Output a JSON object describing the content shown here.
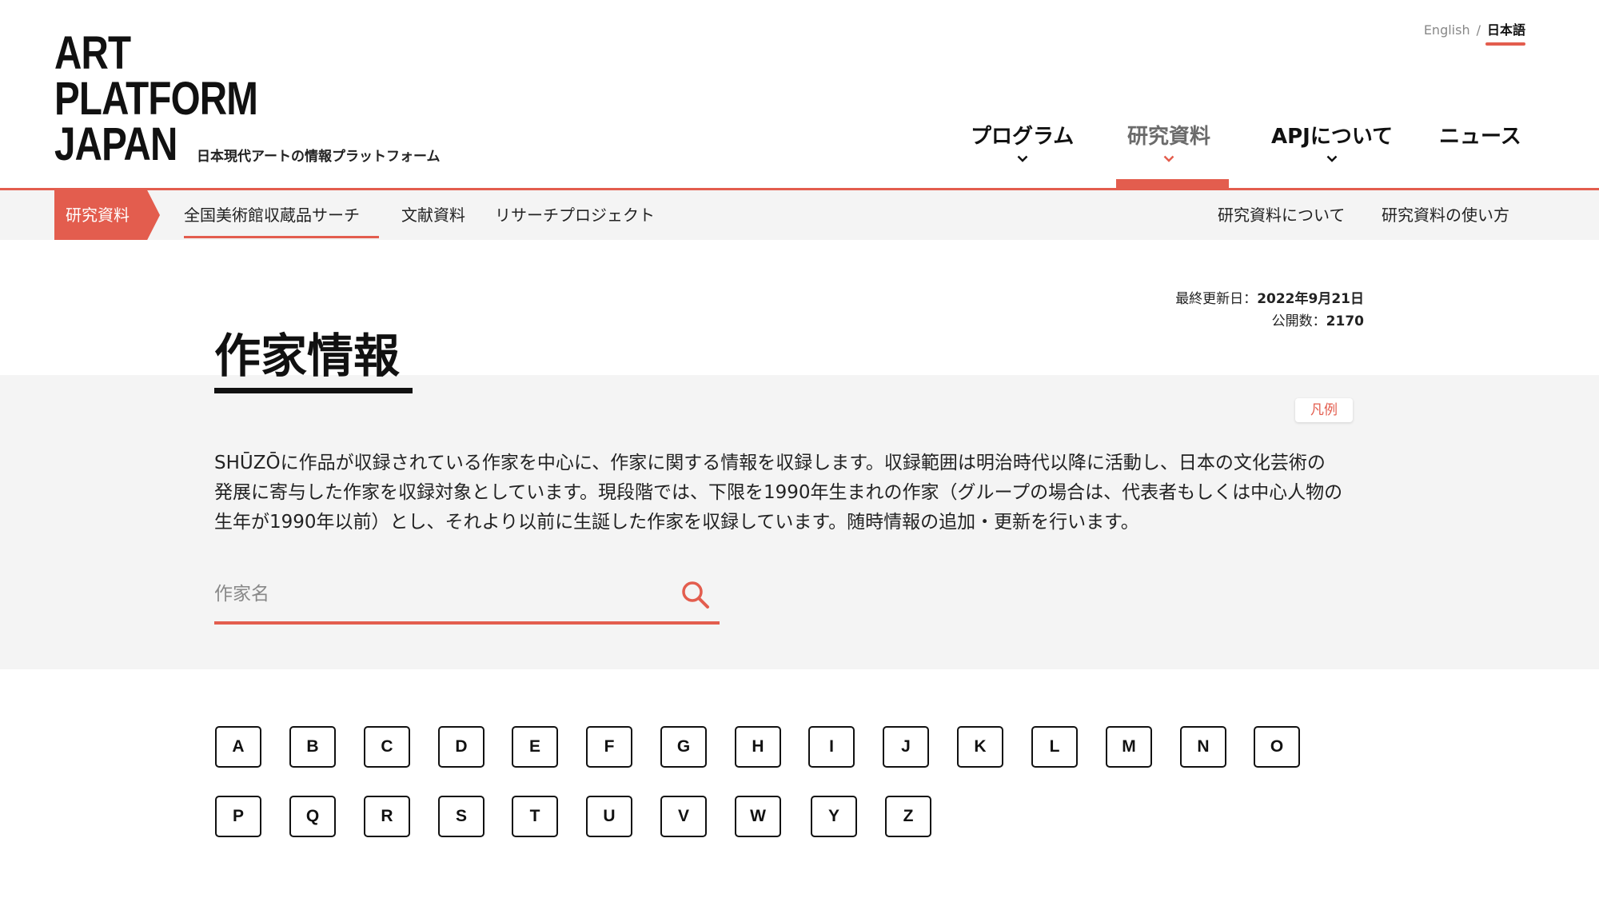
{
  "header": {
    "logo_lines": [
      "ART",
      "PLATFORM",
      "JAPAN"
    ],
    "tagline": "日本現代アートの情報プラットフォーム",
    "lang": {
      "en": "English",
      "separator": "/",
      "ja": "日本語"
    },
    "nav": [
      {
        "label": "プログラム",
        "has_dropdown": true
      },
      {
        "label": "研究資料",
        "has_dropdown": true,
        "active": true
      },
      {
        "label": "APJについて",
        "has_dropdown": true
      },
      {
        "label": "ニュース",
        "has_dropdown": false
      }
    ]
  },
  "subnav": {
    "tag": "研究資料",
    "left_links": [
      "全国美術館収蔵品サーチ",
      "文献資料",
      "リサーチプロジェクト"
    ],
    "right_links": [
      "研究資料について",
      "研究資料の使い方"
    ]
  },
  "meta": {
    "updated_label": "最終更新日：",
    "updated_value": "2022年9月21日",
    "count_label": "公開数：",
    "count_value": "2170"
  },
  "page": {
    "title": "作家情報",
    "legend_button": "凡例",
    "description_lines": [
      "SHŪZŌに作品が収録されている作家を中心に、作家に関する情報を収録します。収録範囲は明治時代以降に活動し、日本の文化芸術の",
      "発展に寄与した作家を収録対象としています。現段階では、下限を1990年生まれの作家（グループの場合は、代表者もしくは中心人物の",
      "生年が1990年以前）とし、それより以前に生誕した作家を収録しています。随時情報の追加・更新を行います。"
    ]
  },
  "search": {
    "placeholder": "作家名",
    "value": "",
    "icon": "search-icon"
  },
  "alphabet": {
    "row1": [
      "A",
      "B",
      "C",
      "D",
      "E",
      "F",
      "G",
      "H",
      "I",
      "J",
      "K",
      "L",
      "M",
      "N",
      "O"
    ],
    "row2": [
      "P",
      "Q",
      "R",
      "S",
      "T",
      "U",
      "V",
      "W",
      "Y",
      "Z"
    ]
  },
  "colors": {
    "accent": "#e35d4e",
    "text": "#111111",
    "band": "#f4f4f4"
  }
}
